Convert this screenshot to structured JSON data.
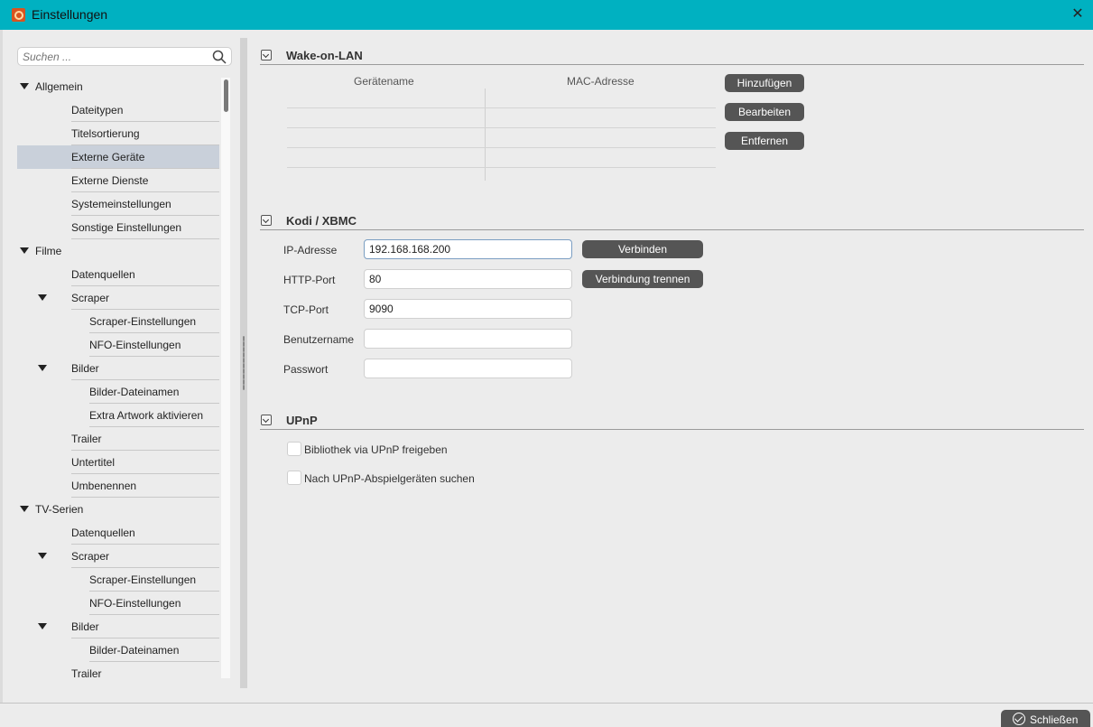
{
  "window": {
    "title": "Einstellungen"
  },
  "search": {
    "placeholder": "Suchen ..."
  },
  "tree": [
    {
      "label": "Allgemein",
      "level": 0,
      "expanded": true
    },
    {
      "label": "Dateitypen",
      "level": 1
    },
    {
      "label": "Titelsortierung",
      "level": 1
    },
    {
      "label": "Externe Geräte",
      "level": 1,
      "selected": true
    },
    {
      "label": "Externe Dienste",
      "level": 1
    },
    {
      "label": "Systemeinstellungen",
      "level": 1
    },
    {
      "label": "Sonstige Einstellungen",
      "level": 1
    },
    {
      "label": "Filme",
      "level": 0,
      "expanded": true
    },
    {
      "label": "Datenquellen",
      "level": 1
    },
    {
      "label": "Scraper",
      "level": 1,
      "expanded": true
    },
    {
      "label": "Scraper-Einstellungen",
      "level": 2
    },
    {
      "label": "NFO-Einstellungen",
      "level": 2
    },
    {
      "label": "Bilder",
      "level": 1,
      "expanded": true
    },
    {
      "label": "Bilder-Dateinamen",
      "level": 2
    },
    {
      "label": "Extra Artwork aktivieren",
      "level": 2
    },
    {
      "label": "Trailer",
      "level": 1
    },
    {
      "label": "Untertitel",
      "level": 1
    },
    {
      "label": "Umbenennen",
      "level": 1
    },
    {
      "label": "TV-Serien",
      "level": 0,
      "expanded": true
    },
    {
      "label": "Datenquellen",
      "level": 1
    },
    {
      "label": "Scraper",
      "level": 1,
      "expanded": true
    },
    {
      "label": "Scraper-Einstellungen",
      "level": 2
    },
    {
      "label": "NFO-Einstellungen",
      "level": 2
    },
    {
      "label": "Bilder",
      "level": 1,
      "expanded": true
    },
    {
      "label": "Bilder-Dateinamen",
      "level": 2
    },
    {
      "label": "Trailer",
      "level": 1
    }
  ],
  "wol": {
    "title": "Wake-on-LAN",
    "columns": [
      "Gerätename",
      "MAC-Adresse"
    ],
    "buttons": {
      "add": "Hinzufügen",
      "edit": "Bearbeiten",
      "remove": "Entfernen"
    }
  },
  "kodi": {
    "title": "Kodi / XBMC",
    "ip_label": "IP-Adresse",
    "ip_value": "192.168.168.200",
    "http_label": "HTTP-Port",
    "http_value": "80",
    "tcp_label": "TCP-Port",
    "tcp_value": "9090",
    "user_label": "Benutzername",
    "user_value": "",
    "pass_label": "Passwort",
    "pass_value": "",
    "connect": "Verbinden",
    "disconnect": "Verbindung trennen"
  },
  "upnp": {
    "title": "UPnP",
    "share_label": "Bibliothek via UPnP freigeben",
    "share_checked": false,
    "search_label": "Nach UPnP-Abspielgeräten suchen",
    "search_checked": false
  },
  "footer": {
    "close": "Schließen"
  }
}
